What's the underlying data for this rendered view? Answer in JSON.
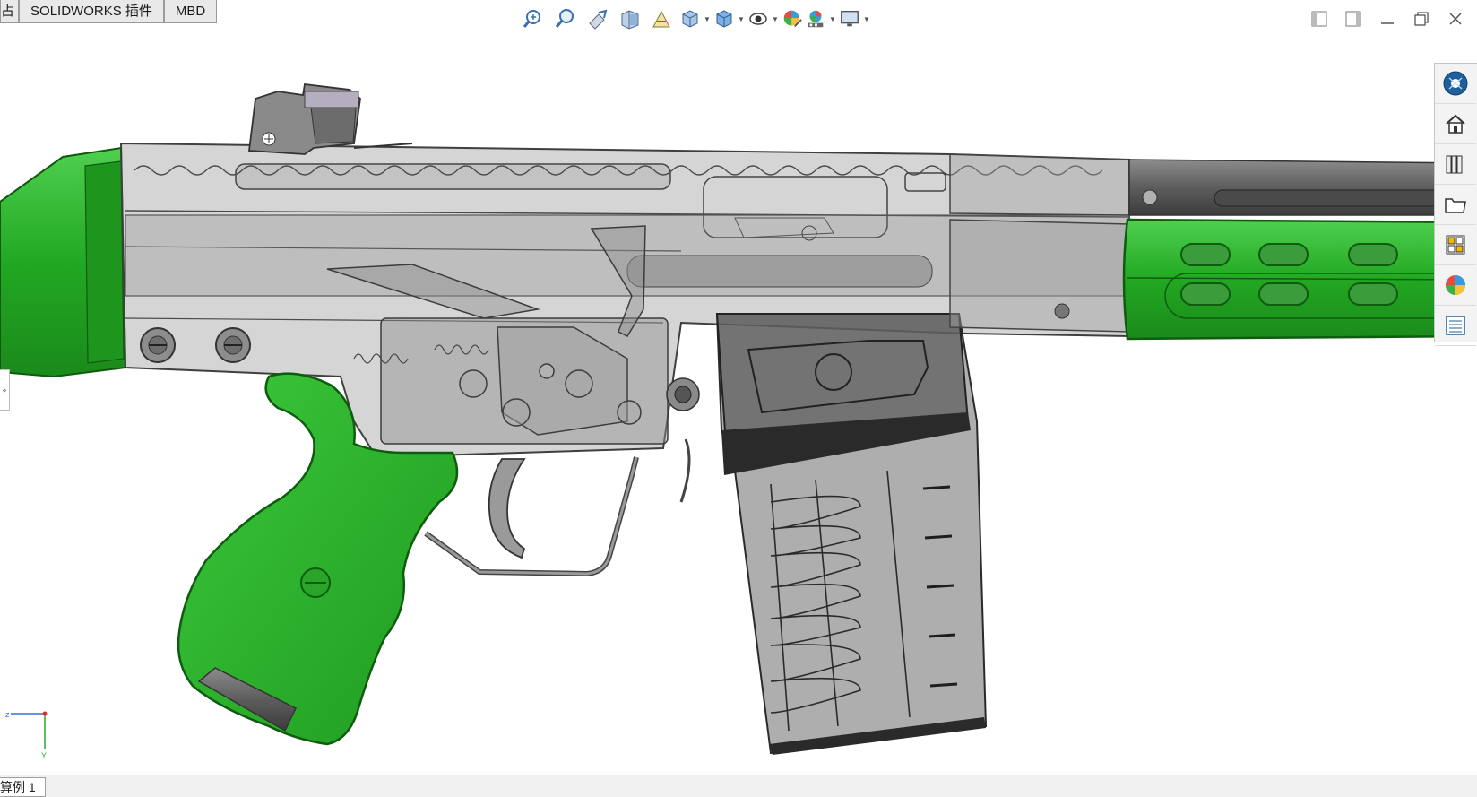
{
  "cmd_tabs": {
    "tab_partial": "占",
    "tab_plugins": "SOLIDWORKS 插件",
    "tab_mbd": "MBD"
  },
  "heads_up_toolbar": [
    {
      "icon": "zoom-to-fit-icon"
    },
    {
      "icon": "zoom-to-area-icon"
    },
    {
      "icon": "previous-view-icon"
    },
    {
      "icon": "section-view-icon"
    },
    {
      "icon": "dynamic-annotation-views-icon"
    },
    {
      "icon": "view-orientation-icon"
    },
    {
      "icon": "display-style-icon"
    },
    {
      "icon": "hide-show-items-icon"
    },
    {
      "icon": "edit-appearance-icon"
    },
    {
      "icon": "apply-scene-icon"
    },
    {
      "icon": "view-settings-icon"
    }
  ],
  "window_controls": [
    "tile-left-icon",
    "tile-right-icon",
    "minimize-icon",
    "restore-icon",
    "close-icon"
  ],
  "task_pane": [
    "solidworks-resources-icon",
    "home-icon",
    "design-library-icon",
    "file-explorer-icon",
    "view-palette-icon",
    "appearances-icon",
    "custom-properties-icon"
  ],
  "statusbar": {
    "sheet_tab": "算例 1"
  },
  "colors": {
    "green_part": "#2db52d",
    "transparent_gray": "#8a8a8a",
    "dark_metal": "#5b5b5b"
  }
}
